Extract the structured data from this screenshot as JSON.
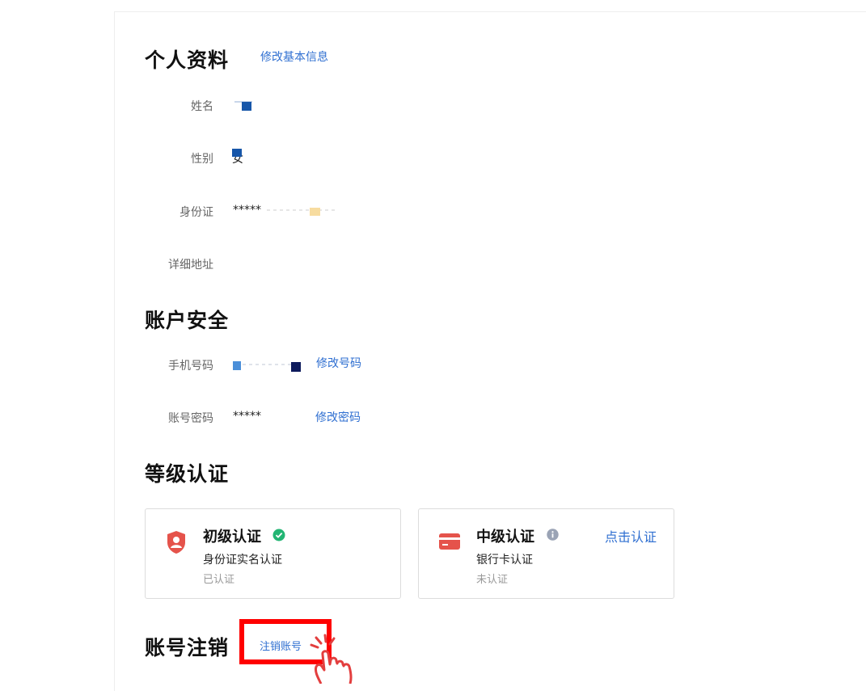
{
  "profile": {
    "title": "个人资料",
    "edit_link": "修改基本信息",
    "name_label": "姓名",
    "gender_label": "性别",
    "gender_value": "女",
    "id_label": "身份证",
    "id_value": "*****",
    "address_label": "详细地址"
  },
  "security": {
    "title": "账户安全",
    "phone_label": "手机号码",
    "phone_edit": "修改号码",
    "password_label": "账号密码",
    "password_value": "*****",
    "password_edit": "修改密码"
  },
  "level": {
    "title": "等级认证",
    "cards": [
      {
        "title": "初级认证",
        "desc": "身份证实名认证",
        "state": "已认证",
        "icon": "shield-user-icon",
        "badge": "check-circle-icon",
        "color": "#e5534b"
      },
      {
        "title": "中级认证",
        "desc": "银行卡认证",
        "state": "未认证",
        "icon": "bank-card-icon",
        "badge": "info-icon",
        "action": "点击认证",
        "color": "#e5534b"
      }
    ]
  },
  "cancel": {
    "title": "账号注销",
    "link": "注销账号"
  },
  "colors": {
    "accent": "#2f6fd1",
    "success": "#22b573",
    "danger": "#e5534b",
    "highlight": "#ff0000"
  }
}
